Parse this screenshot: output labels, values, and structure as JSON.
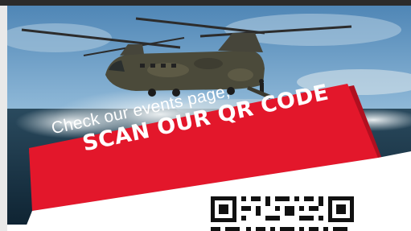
{
  "banner": {
    "line1": "Check our events page,",
    "line2": "SCAN OUR QR CODE"
  },
  "colors": {
    "banner_red": "#e3172b",
    "banner_shadow": "#b01020",
    "sky": "#8fb8d8",
    "sea": "#173247",
    "helicopter": "#4b4a3a"
  },
  "icons": {
    "helicopter": "chinook-helicopter-photo",
    "qr": "qr-code-icon"
  }
}
